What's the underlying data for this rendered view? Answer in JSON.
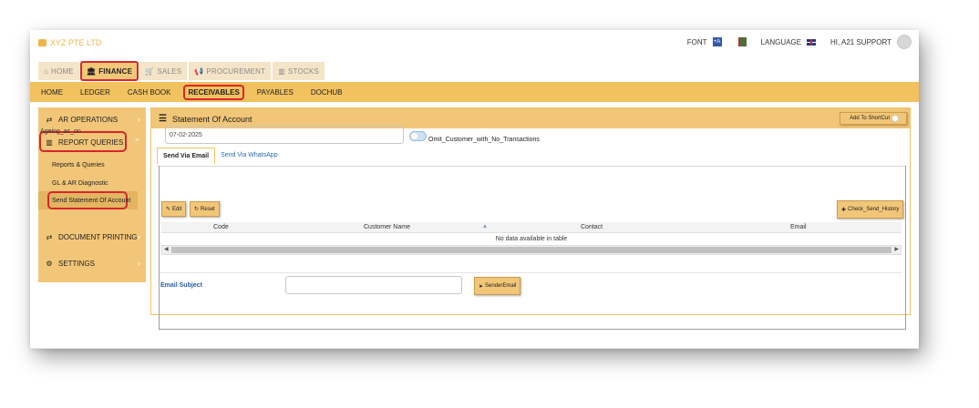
{
  "app": {
    "brand": "XYZ PTE LTD"
  },
  "topbar": {
    "font_label": "FONT",
    "font_box": "+A",
    "language_label": "LANGUAGE",
    "user_greeting": "HI, A21 SUPPORT"
  },
  "modules": [
    {
      "label": "HOME",
      "icon": "home-icon"
    },
    {
      "label": "FINANCE",
      "icon": "bank-icon"
    },
    {
      "label": "SALES",
      "icon": "cart-icon"
    },
    {
      "label": "PROCUREMENT",
      "icon": "megaphone-icon"
    },
    {
      "label": "STOCKS",
      "icon": "chart-icon"
    }
  ],
  "subnav": [
    "HOME",
    "LEDGER",
    "CASH BOOK",
    "RECEIVABLES",
    "PAYABLES",
    "DOCHUB"
  ],
  "sidebar": {
    "ar_operations": "AR OPERATIONS",
    "report_queries": "REPORT QUERIES",
    "sub_items": [
      "Reports & Queries",
      "GL & AR Diagnostic",
      "Send Statement Of Account"
    ],
    "document_printing": "DOCUMENT PRINTING",
    "settings": "SETTINGS"
  },
  "page": {
    "title": "Statement Of Account",
    "shortcut_label": "Add To ShortCut",
    "tabs": [
      "Send Via Email",
      "Send Via WhatsApp"
    ],
    "ageing_label": "Ageing_as_on",
    "ageing_value": "07-02-2025",
    "omit_label": "Omit_Customer_with_No_Transactions",
    "edit_label": "Edit",
    "reset_label": "Reset",
    "history_label": "Check_Send_History",
    "table": {
      "columns": [
        "Code",
        "Customer Name",
        "Contact",
        "Email"
      ],
      "empty_text": "No data available in table"
    },
    "email_subject_label": "Email Subject",
    "send_label": "SenderEmail"
  },
  "colors": {
    "accent": "#f2c25f",
    "highlight": "#d7262a",
    "brand": "#f0b54a"
  }
}
